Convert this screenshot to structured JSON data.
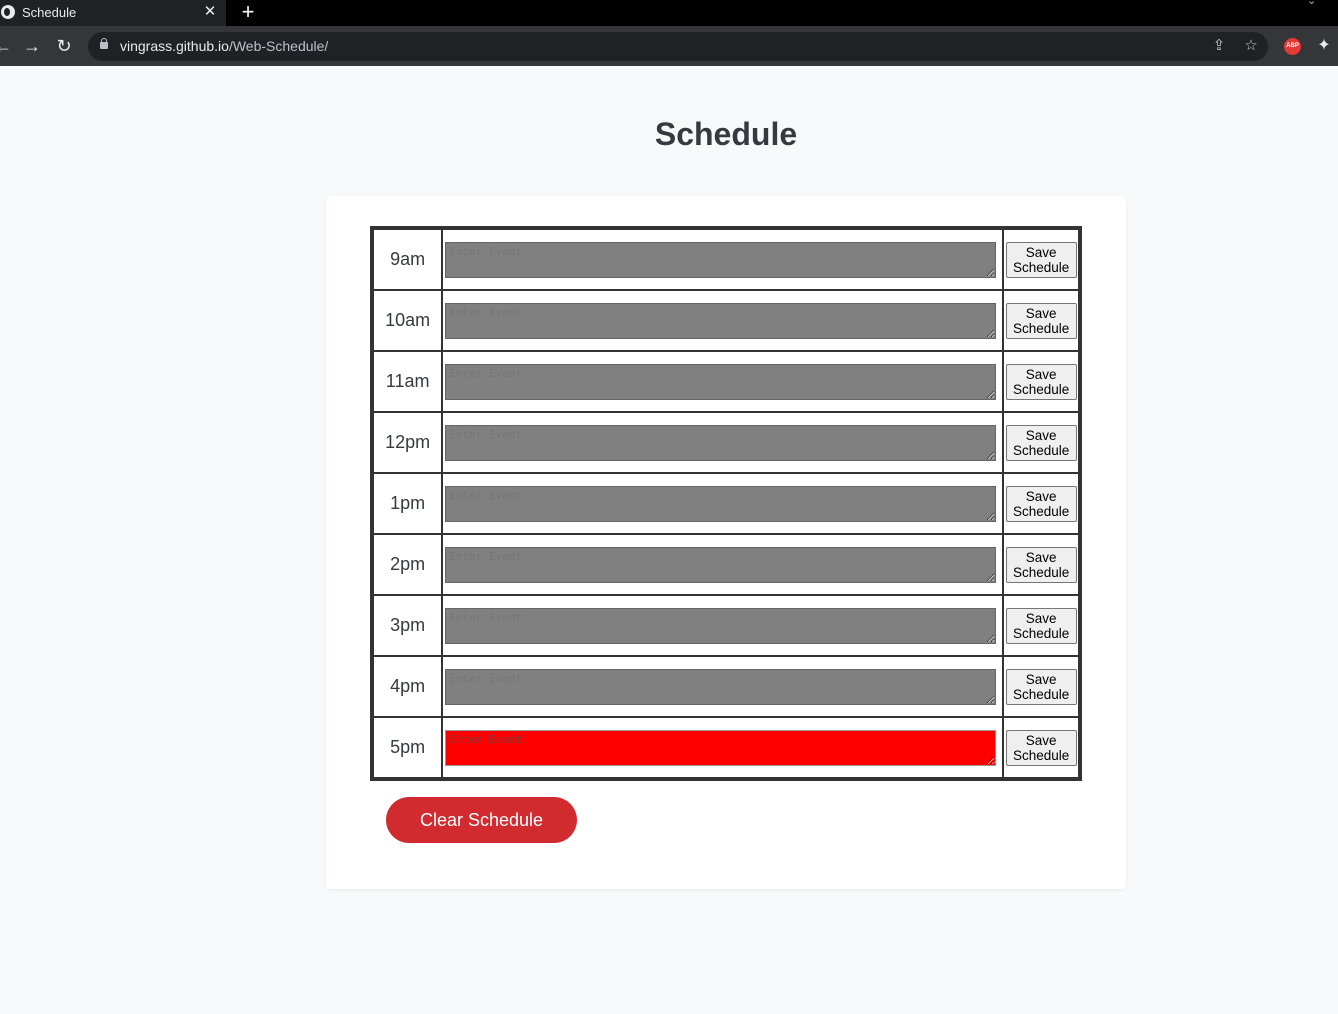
{
  "browser": {
    "tab_title": "Schedule",
    "url_host": "vingrass.github.io",
    "url_path": "/Web-Schedule/",
    "extension_label": "ABP"
  },
  "page": {
    "title": "Schedule"
  },
  "schedule": {
    "placeholder": "Enter Event",
    "save_label": "Save\nSchedule",
    "rows": [
      {
        "hour": "9am",
        "state": "past"
      },
      {
        "hour": "10am",
        "state": "past"
      },
      {
        "hour": "11am",
        "state": "past"
      },
      {
        "hour": "12pm",
        "state": "past"
      },
      {
        "hour": "1pm",
        "state": "past"
      },
      {
        "hour": "2pm",
        "state": "past"
      },
      {
        "hour": "3pm",
        "state": "past"
      },
      {
        "hour": "4pm",
        "state": "past"
      },
      {
        "hour": "5pm",
        "state": "present"
      }
    ]
  },
  "clear_label": "Clear Schedule",
  "colors": {
    "past": "#808080",
    "present": "#ff0000",
    "clear_button": "#d22b2f",
    "title": "#343a40"
  }
}
